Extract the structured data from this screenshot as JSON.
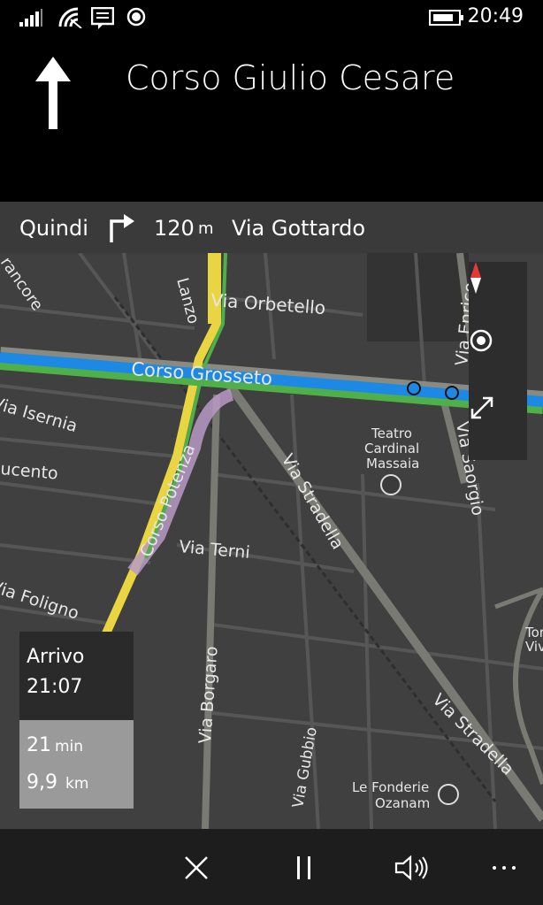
{
  "status": {
    "time": "20:49",
    "icons": [
      "signal-icon",
      "wifi-icon",
      "message-icon",
      "record-icon",
      "battery-icon"
    ]
  },
  "instruction": {
    "direction_icon": "arrow-up-icon",
    "street": "Corso Giulio Cesare"
  },
  "next": {
    "label": "Quindi",
    "turn_icon": "turn-right-icon",
    "distance_value": "120",
    "distance_unit": "m",
    "street": "Via Gottardo"
  },
  "map": {
    "labels": {
      "corso_grosseto": "Corso Grosseto",
      "via_orbetello": "Via Orbetello",
      "via_enrico": "Via Enrico",
      "via_saorgio": "Via Saorgio",
      "via_isernia": "Via Isernia",
      "ucento": "ucento",
      "corso_potenza": "Corso Potenza",
      "via_stradella_1": "Via Stradella",
      "via_stradella_2": "Via Stradella",
      "via_terni": "Via Terni",
      "via_foligno": "Via Foligno",
      "via_borgaro": "Via Borgaro",
      "via_gubbio": "Via Gubbio",
      "teatro_1": "Teatro",
      "teatro_2": "Cardinal",
      "teatro_3": "Massaia",
      "fonderie_1": "Le Fonderie",
      "fonderie_2": "Ozanam",
      "lanzo": "Lanzo",
      "rancore": "rancore",
      "tor_1": "Tor",
      "tor_2": "Viv"
    },
    "controls": [
      "compass-icon",
      "locate-icon",
      "expand-icon"
    ]
  },
  "eta": {
    "arrival_label": "Arrivo",
    "arrival_time": "21:07",
    "duration_value": "21",
    "duration_unit": "min",
    "distance_value": "9,9",
    "distance_unit": "km"
  },
  "bottom": {
    "buttons": [
      "close-icon",
      "pause-icon",
      "volume-icon",
      "more-icon"
    ]
  }
}
